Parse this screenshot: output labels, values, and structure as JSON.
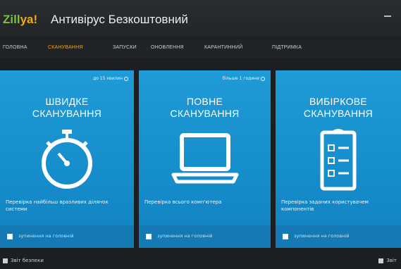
{
  "app": {
    "logo_part1": "Zill",
    "logo_part2": "ya!",
    "title": "Антивірус Безкоштовний"
  },
  "nav": {
    "items": [
      {
        "label": "ГОЛОВНА"
      },
      {
        "label": "СКАНУВАННЯ"
      },
      {
        "label": "ЗАПУСКИ"
      },
      {
        "label": "ОНОВЛЕННЯ"
      },
      {
        "label": "КАРАНТИННИЙ"
      },
      {
        "label": "ПІДТРИМКА"
      }
    ],
    "active_index": 1
  },
  "cards": [
    {
      "top_note": "до 15 хвилин",
      "title_line1": "ШВИДКЕ",
      "title_line2": "СКАНУВАННЯ",
      "icon": "stopwatch-icon",
      "desc": "Перевірка найбільш вразливих ділянок системи",
      "foot_label": "зупинення на головній"
    },
    {
      "top_note": "більше 1 години",
      "title_line1": "ПОВНЕ",
      "title_line2": "СКАНУВАННЯ",
      "icon": "laptop-icon",
      "desc": "Перевірка всього комп'ютера",
      "foot_label": "зупинення на головній"
    },
    {
      "top_note": "",
      "title_line1": "ВИБІРКОВЕ",
      "title_line2": "СКАНУВАННЯ",
      "icon": "checklist-icon",
      "desc": "Перевірка заданих користувачем компонентів",
      "foot_label": "зупинення на головній"
    }
  ],
  "bottom": {
    "left_label": "Звіт безпеки",
    "right_label": "Звіт"
  },
  "colors": {
    "accent": "#f3a21f",
    "card_blue": "#1a93d1",
    "background": "#1c1f22"
  }
}
